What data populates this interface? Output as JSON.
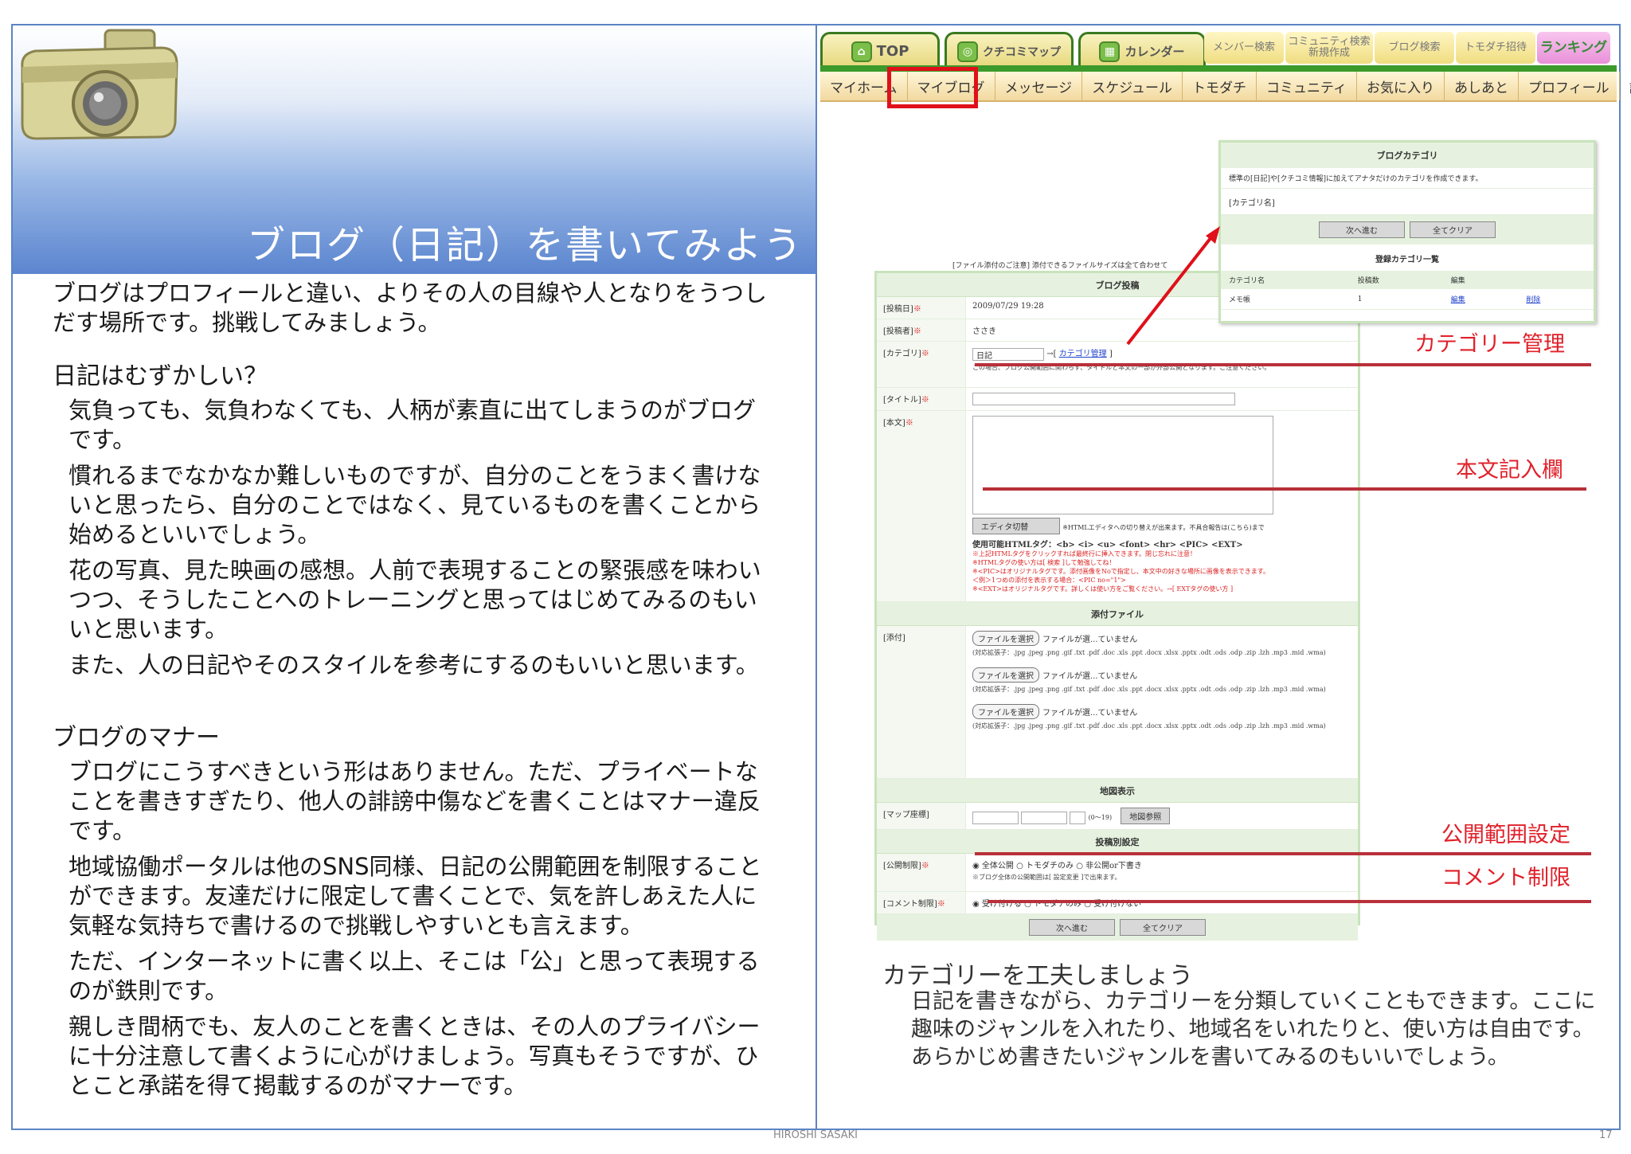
{
  "page": {
    "title": "ブログ（日記）を書いてみよう",
    "author": "HIROSHI SASAKI",
    "page_number": "17"
  },
  "left": {
    "intro": "ブログはプロフィールと違い、よりその人の目線や人となりをうつしだす場所です。挑戦してみましょう。",
    "section1_title": "日記はむずかしい？",
    "section1_paras": [
      "気負っても、気負わなくても、人柄が素直に出てしまうのがブログです。",
      "慣れるまでなかなか難しいものですが、自分のことをうまく書けないと思ったら、自分のことではなく、見ているものを書くことから始めるといいでしょう。",
      "花の写真、見た映画の感想。人前で表現することの緊張感を味わいつつ、そうしたことへのトレーニングと思ってはじめてみるのもいいと思います。",
      "また、人の日記やそのスタイルを参考にするのもいいと思います。"
    ],
    "section2_title": "ブログのマナー",
    "section2_paras": [
      "ブログにこうすべきという形はありません。ただ、プライベートなことを書きすぎたり、他人の誹謗中傷などを書くことはマナー違反です。",
      "地域協働ポータルは他のSNS同様、日記の公開範囲を制限することができます。友達だけに限定して書くことで、気を許しあえた人に気軽な気持ちで書けるので挑戦しやすいとも言えます。",
      "ただ、インターネットに書く以上、そこは「公」と思って表現するのが鉄則です。",
      "親しき間柄でも、友人のことを書くときは、その人のプライバシーに十分注意して書くように心がけましょう。写真もそうですが、ひとこと承諾を得て掲載するのがマナーです。"
    ]
  },
  "nav": {
    "top_tabs": [
      "TOP",
      "クチコミマップ",
      "カレンダー"
    ],
    "small_tabs": [
      "メンバー検索",
      "コミュニティ検索新規作成",
      "ブログ検索",
      "トモダチ招待",
      "ランキング"
    ],
    "sub_items": [
      "マイホーム",
      "マイブログ",
      "メッセージ",
      "スケジュール",
      "トモダチ",
      "コミュニティ",
      "お気に入り",
      "あしあと",
      "プロフィール",
      "設定変更"
    ]
  },
  "form": {
    "file_notice": "[ファイル添付のご注意] 添付できるファイルサイズは全て合わせて",
    "header": "ブログ投稿",
    "labels": {
      "date": "[投稿日]",
      "author": "[投稿者]",
      "category": "[カテゴリ]",
      "title": "[タイトル]",
      "body": "[本文]",
      "attach": "[添付]",
      "map": "[マップ座標]",
      "visibility": "[公開制限]",
      "comment": "[コメント制限]"
    },
    "date_value": "2009/07/29 19:28",
    "author_value": "ささき",
    "category_value": "日記",
    "category_link": "カテゴリ管理",
    "category_note": "この場合、ブログ公開範囲に関わらず、タイトルと本文の一部が外部公開となります。ご注意ください。",
    "editor_button": "エディタ切替",
    "editor_note": "※HTMLエディタへの切り替えが出来ます。不具合報告は(こちら)まで",
    "html_tags": "使用可能HTMLタグ：<b> <i> <u> <font> <hr> <PIC> <EXT>",
    "notes_red": [
      "※上記HTMLタグをクリックすれば最終行に挿入できます。閉じ忘れに注意！",
      "※HTMLタグの使い方は[ 検索 ]して勉強してね！",
      "※<PIC>はオリジナルタグです。添付画像をNoで指定し、本文中の好きな場所に画像を表示できます。",
      "＜例＞1つめの添付を表示する場合：<PIC no=\"1\">",
      "※<EXT>はオリジナルタグです。詳しくは使い方をご覧ください。→[ EXTタグの使い方 ]"
    ],
    "attach_header": "添付ファイル",
    "file_button": "ファイルを選択",
    "file_status": "ファイルが選...ていません",
    "file_ext": "(対応拡張子：.jpg .jpeg .png .gif .txt .pdf .doc .xls .ppt .docx .xlsx .pptx .odt .ods .odp .zip .lzh .mp3 .mid .wma)",
    "map_header": "地図表示",
    "map_range": "(0〜19)",
    "map_button": "地図参照",
    "settings_header": "投稿別設定",
    "visibility_options": [
      "全体公開",
      "トモダチのみ",
      "非公開or下書き"
    ],
    "visibility_note": "※ブログ全体の公開範囲は[ 設定変更 ]で出来ます。",
    "comment_options": [
      "受け付ける",
      "トモダチのみ",
      "受け付けない"
    ],
    "next_button": "次へ進む",
    "clear_button": "全てクリア"
  },
  "category_panel": {
    "header": "ブログカテゴリ",
    "desc": "標準の[日記]や[クチコミ情報]に加えてアナタだけのカテゴリを作成できます。",
    "name_label": "[カテゴリ名]",
    "next_button": "次へ進む",
    "clear_button": "全てクリア",
    "list_title": "登録カテゴリ一覧",
    "columns": [
      "カテゴリ名",
      "投稿数",
      "編集",
      ""
    ],
    "rows": [
      [
        "メモ帳",
        "1",
        "編集",
        "削除"
      ]
    ]
  },
  "annotations": {
    "category": "カテゴリー管理",
    "body": "本文記入欄",
    "visibility": "公開範囲設定",
    "comment": "コメント制限"
  },
  "bottom": {
    "title": "カテゴリーを工夫しましょう",
    "text": "日記を書きながら、カテゴリーを分類していくこともできます。ここに趣味のジャンルを入れたり、地域名をいれたりと、使い方は自由です。あらかじめ書きたいジャンルを書いてみるのもいいでしょう。"
  },
  "colors": {
    "accent_blue": "#5b85c4",
    "annotation_red": "#e0202a",
    "form_green": "#c9e3bc"
  }
}
